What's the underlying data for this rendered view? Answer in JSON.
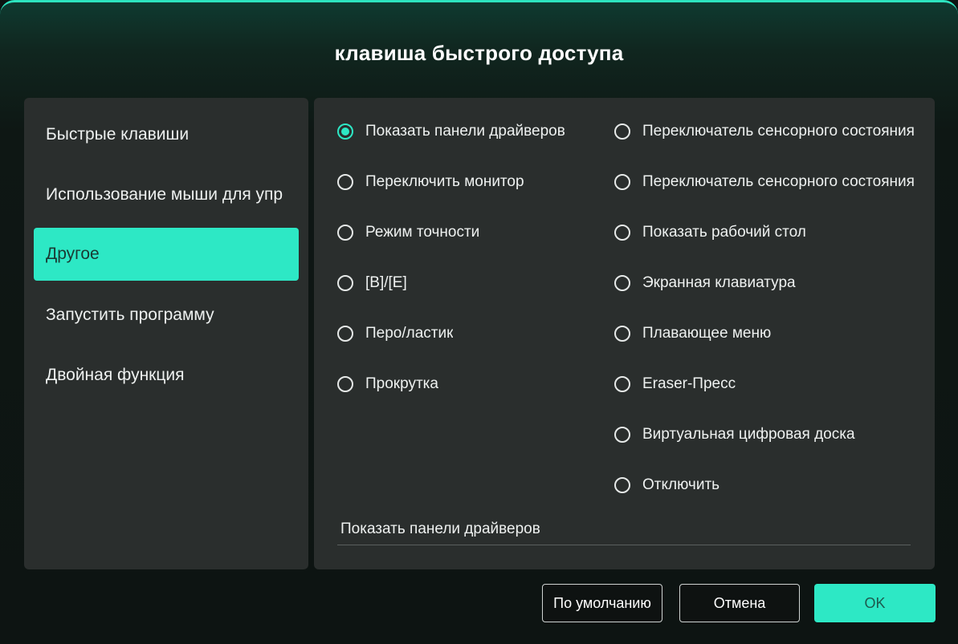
{
  "dialog": {
    "title": "клавиша быстрого доступа"
  },
  "sidebar": {
    "items": [
      {
        "label": "Быстрые клавиши",
        "active": false
      },
      {
        "label": "Использование мыши для упр",
        "active": false
      },
      {
        "label": "Другое",
        "active": true
      },
      {
        "label": "Запустить программу",
        "active": false
      },
      {
        "label": "Двойная функция",
        "active": false
      }
    ]
  },
  "options": {
    "left": [
      {
        "label": "Показать панели драйверов",
        "checked": true
      },
      {
        "label": "Переключить монитор",
        "checked": false
      },
      {
        "label": "Режим точности",
        "checked": false
      },
      {
        "label": "[B]/[E]",
        "checked": false
      },
      {
        "label": "Перо/ластик",
        "checked": false
      },
      {
        "label": "Прокрутка",
        "checked": false
      }
    ],
    "right": [
      {
        "label": "Переключатель сенсорного состояния",
        "checked": false
      },
      {
        "label": "Переключатель сенсорного состояния",
        "checked": false
      },
      {
        "label": "Показать рабочий стол",
        "checked": false
      },
      {
        "label": "Экранная клавиатура",
        "checked": false
      },
      {
        "label": "Плавающее меню",
        "checked": false
      },
      {
        "label": "Eraser-Пресс",
        "checked": false
      },
      {
        "label": "Виртуальная цифровая доска",
        "checked": false
      },
      {
        "label": "Отключить",
        "checked": false
      }
    ]
  },
  "description": "Показать панели драйверов",
  "buttons": {
    "default_label": "По умолчанию",
    "cancel_label": "Отмена",
    "ok_label": "OK"
  },
  "colors": {
    "accent": "#2de8c5",
    "panel": "#2a2e2d",
    "background": "#0d1412"
  }
}
